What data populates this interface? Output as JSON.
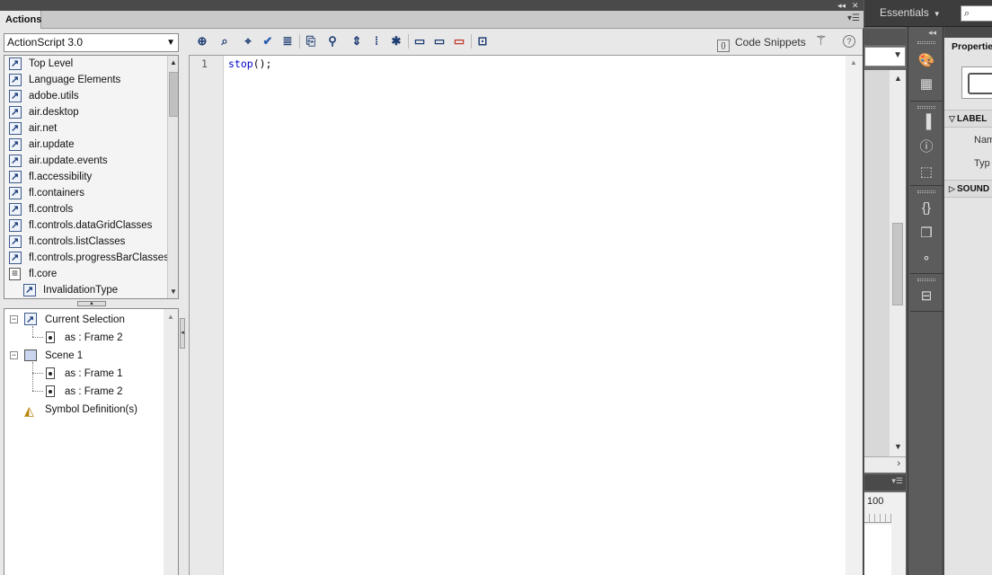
{
  "actions_panel": {
    "tab_label": "Actions",
    "language_select": "ActionScript 3.0",
    "toolbox_items": [
      {
        "label": "Top Level",
        "icon": "package-icon",
        "indent": 0
      },
      {
        "label": "Language Elements",
        "icon": "package-icon",
        "indent": 0
      },
      {
        "label": "adobe.utils",
        "icon": "package-icon",
        "indent": 0
      },
      {
        "label": "air.desktop",
        "icon": "package-icon",
        "indent": 0
      },
      {
        "label": "air.net",
        "icon": "package-icon",
        "indent": 0
      },
      {
        "label": "air.update",
        "icon": "package-icon",
        "indent": 0
      },
      {
        "label": "air.update.events",
        "icon": "package-icon",
        "indent": 0
      },
      {
        "label": "fl.accessibility",
        "icon": "package-icon",
        "indent": 0
      },
      {
        "label": "fl.containers",
        "icon": "package-icon",
        "indent": 0
      },
      {
        "label": "fl.controls",
        "icon": "package-icon",
        "indent": 0
      },
      {
        "label": "fl.controls.dataGridClasses",
        "icon": "package-icon",
        "indent": 0
      },
      {
        "label": "fl.controls.listClasses",
        "icon": "package-icon",
        "indent": 0
      },
      {
        "label": "fl.controls.progressBarClasses",
        "icon": "package-icon",
        "indent": 0
      },
      {
        "label": "fl.core",
        "icon": "class-icon",
        "indent": 0
      },
      {
        "label": "InvalidationType",
        "icon": "package-icon",
        "indent": 1
      }
    ],
    "script_navigator": {
      "current_selection": "Current Selection",
      "current_frame": "as : Frame 2",
      "scene": "Scene 1",
      "scene_frames": [
        "as : Frame 1",
        "as : Frame 2"
      ],
      "symbol_definitions": "Symbol Definition(s)"
    },
    "toolbar": {
      "code_snippets_label": "Code Snippets",
      "help_label": "?"
    },
    "editor": {
      "line_number": "1",
      "code_keyword": "stop",
      "code_punct": "();"
    }
  },
  "workspace": {
    "switcher_label": "Essentials",
    "timeline_frame_label": "100"
  },
  "properties": {
    "tab_label": "Properties",
    "label_section": "LABEL",
    "name_field": "Nam",
    "type_field": "Typ",
    "sound_section": "SOUND"
  },
  "colors": {
    "code_keyword": "#0000cc",
    "panel_bg": "#e8e8e8",
    "chrome_dark": "#4a4a4a"
  }
}
